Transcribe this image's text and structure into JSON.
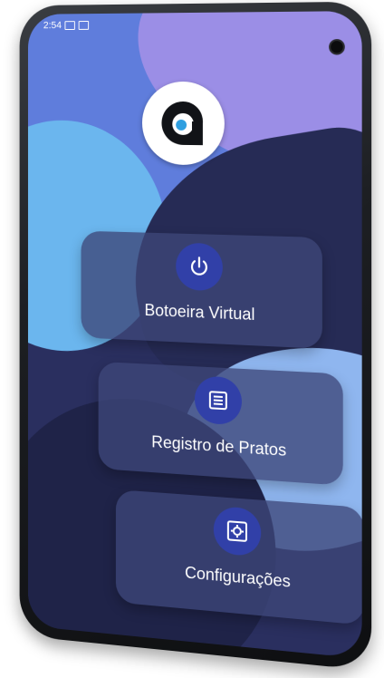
{
  "status_bar": {
    "time": "2:54"
  },
  "app": {
    "logo_icon": "app-logo-a-icon"
  },
  "menu": [
    {
      "label": "Botoeira Virtual",
      "icon": "power-icon"
    },
    {
      "label": "Registro de Pratos",
      "icon": "list-icon"
    },
    {
      "label": "Configurações",
      "icon": "gear-icon"
    }
  ],
  "colors": {
    "icon_circle": "#3140a8",
    "card_bg": "#3e4678"
  }
}
